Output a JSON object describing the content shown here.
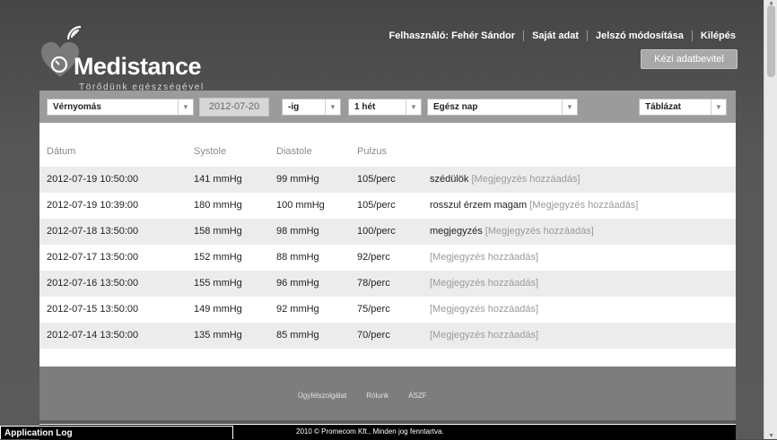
{
  "brand": {
    "name": "Medistance",
    "tagline": "Törődünk egészségével"
  },
  "top_nav": {
    "user_label": "Felhasználó: Fehér Sándor",
    "my_data": "Saját adat",
    "change_password": "Jelszó módosítása",
    "logout": "Kilépés",
    "manual_entry": "Kézi adatbevitel"
  },
  "filters": {
    "measurement_type": "Vérnyomás",
    "date": "2012-07-20",
    "date_mode": "-ig",
    "period": "1 hét",
    "time_of_day": "Egész nap",
    "view": "Táblázat"
  },
  "table": {
    "headers": {
      "date": "Dátum",
      "systole": "Systole",
      "diastole": "Diastole",
      "pulse": "Pulzus"
    },
    "rows": [
      {
        "date": "2012-07-19 10:50:00",
        "systole": "141 mmHg",
        "diastole": "99 mmHg",
        "pulse": "105/perc",
        "note": "szédülök",
        "add_note": "[Megjegyzés hozzáadás]"
      },
      {
        "date": "2012-07-19 10:39:00",
        "systole": "180 mmHg",
        "diastole": "100 mmHg",
        "pulse": "105/perc",
        "note": "rosszul érzem magam",
        "add_note": "[Megjegyzés hozzáadás]"
      },
      {
        "date": "2012-07-18 13:50:00",
        "systole": "158 mmHg",
        "diastole": "98 mmHg",
        "pulse": "100/perc",
        "note": "megjegyzés",
        "add_note": "[Megjegyzés hozzáadás]"
      },
      {
        "date": "2012-07-17 13:50:00",
        "systole": "152 mmHg",
        "diastole": "88 mmHg",
        "pulse": "92/perc",
        "note": "",
        "add_note": "[Megjegyzés hozzáadás]"
      },
      {
        "date": "2012-07-16 13:50:00",
        "systole": "155 mmHg",
        "diastole": "96 mmHg",
        "pulse": "78/perc",
        "note": "",
        "add_note": "[Megjegyzés hozzáadás]"
      },
      {
        "date": "2012-07-15 13:50:00",
        "systole": "149 mmHg",
        "diastole": "92 mmHg",
        "pulse": "75/perc",
        "note": "",
        "add_note": "[Megjegyzés hozzáadás]"
      },
      {
        "date": "2012-07-14 13:50:00",
        "systole": "135 mmHg",
        "diastole": "85 mmHg",
        "pulse": "70/perc",
        "note": "",
        "add_note": "[Megjegyzés hozzáadás]"
      }
    ]
  },
  "footer": {
    "links": [
      "Ügyfélszolgálat",
      "Rólunk",
      "ÁSZF"
    ],
    "copyright": "2010 © Promecom Kft., Minden jog fenntartva."
  },
  "app_log": "Application Log"
}
